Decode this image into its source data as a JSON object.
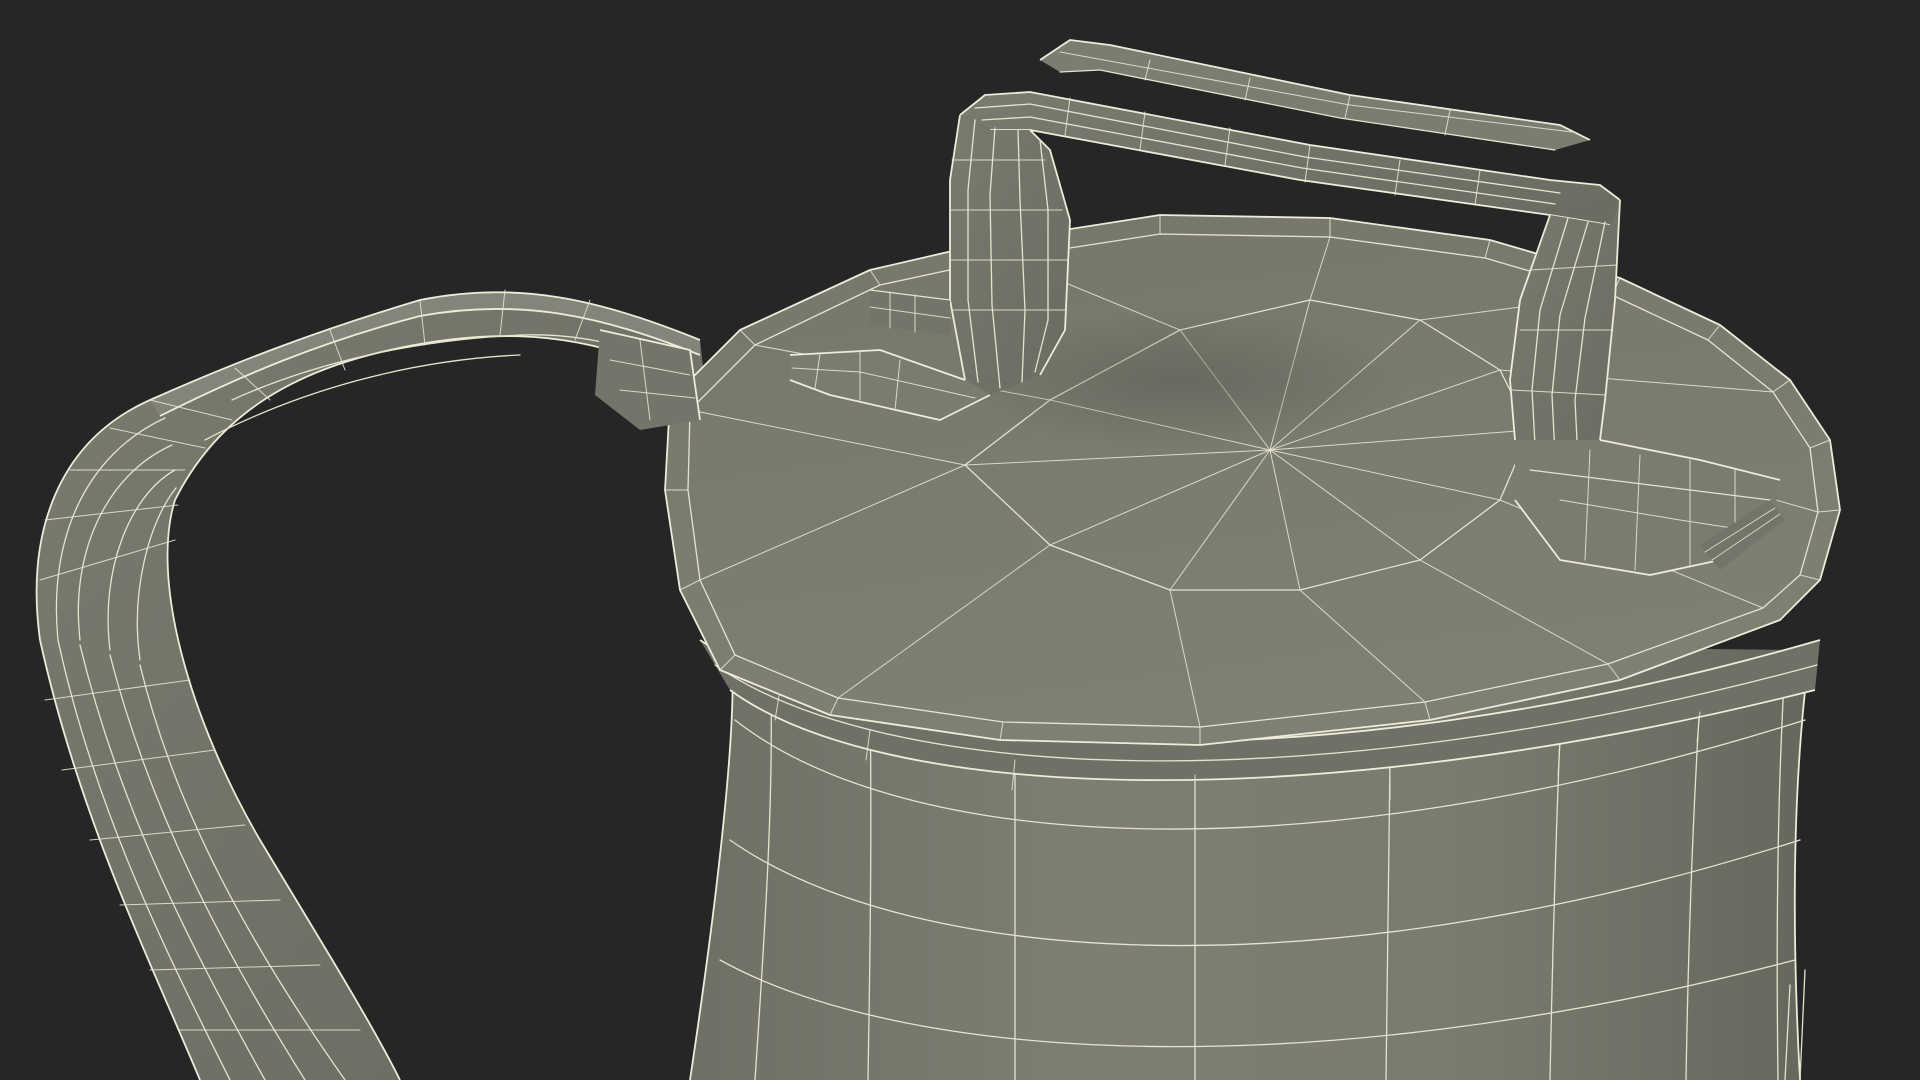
{
  "scene": {
    "subject": "wireframe-mesh-render",
    "colors": {
      "background": "#262626",
      "surface": "#7b7c70",
      "surface_dark": "#5d5e55",
      "surface_light": "#8a8b7e",
      "wireframe": "#e6e3cf"
    }
  }
}
